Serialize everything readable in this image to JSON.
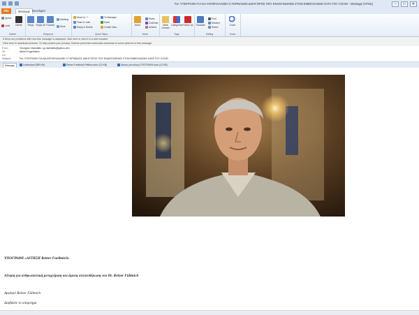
{
  "window": {
    "title": "Fw: ΥΠΟΓΡΑΦΗ ΓΙΑ ΝΑ ΑΠΟΦΥΛΑΧΘΕΙ Ο ΓΕΡΜΑΝΟΣ ΔΙΚΗΓΟΡΟΣ ΠΟΥ ΕΝΑΝΤΙΩΘΗΚΕ ΣΤΟΝ ΕΜΒΟΛΙΑΣΜΟ ΚΑΤΑ ΤΟΥ COVID - Message (HTML)",
    "controls": [
      "–",
      "□",
      "✕"
    ]
  },
  "tabs": {
    "file": "File",
    "message": "Message",
    "developer": "Developer"
  },
  "ribbon": {
    "delete_group": {
      "label": "Delete",
      "ignore": "Ignore",
      "junk": "Junk",
      "delete": "Delete"
    },
    "respond_group": {
      "label": "Respond",
      "reply": "Reply",
      "reply_all": "Reply All",
      "forward": "Forward",
      "meeting": "Meeting",
      "more": "More"
    },
    "quicksteps_group": {
      "label": "Quick Steps",
      "move_to": "Move to: ?",
      "team_email": "Team E-mail",
      "reply_delete": "Reply & Delete",
      "to_manager": "To Manager",
      "done": "Done",
      "create_new": "Create New"
    },
    "move_group": {
      "label": "Move",
      "move": "Move",
      "rules": "Rules",
      "onenote": "OneNote",
      "actions": "Actions"
    },
    "tags_group": {
      "label": "Tags",
      "mark_unread": "Mark Unread",
      "categorize": "Categorize",
      "follow_up": "Follow Up"
    },
    "editing_group": {
      "label": "Editing",
      "translate": "Translate",
      "find": "Find",
      "related": "Related",
      "select": "Select"
    },
    "zoom_group": {
      "label": "Zoom",
      "zoom": "Zoom"
    }
  },
  "infobar": {
    "line1": "If there are problems with how this message is displayed, click here to view it in a web browser.",
    "line2": "Click here to download pictures. To help protect your privacy, Outlook prevented automatic download of some pictures in this message."
  },
  "header": {
    "from_label": "From:",
    "from_value": "Georgios Vlachakis <g.vlachakis@yahoo.de>",
    "to_label": "To:",
    "to_value": "Albert Engelmann",
    "cc_label": "Cc:",
    "cc_value": "",
    "subject_label": "Subject:",
    "subject_value": "Fw: ΥΠΟΓΡΑΦΗ ΓΙΑ ΝΑ ΑΠΟΦΥΛΑΧΘΕΙ Ο ΓΕΡΜΑΝΟΣ ΔΙΚΗΓΟΡΟΣ ΠΟΥ ΕΝΑΝΤΙΩΘΗΚΕ ΣΤΟΝ ΕΜΒΟΛΙΑΣΜΟ ΚΑΤΑ ΤΟΥ COVID"
  },
  "attachments": {
    "message_tab": "Message",
    "items": [
      "Lebenslauf (559 KB)",
      "Reiner Fuellmich Petition.docx (13 KB)",
      "Αίτηση για εκλογή ΥΠΟΓΡΑΦΗ.docx (12 KB)"
    ]
  },
  "body": {
    "line1": "ΥΠΟΓΡΑΦΗ «ΑΙΤΗΣΗ Reiner Fuellmich»",
    "line2": "Αίτηση για ανθρωπιστική μεταχείριση και άμεση απελευθέρωση του Dr. Reiner Füllmich",
    "line3": "Αγαπητέ Reiner Füllmich",
    "line4": "Διαβάστε το υπόμνημα"
  },
  "colors": {
    "file_tab": "#e07a1f",
    "ribbon_bg": "#e6edf7",
    "attachment_icon": "#2f6fbd"
  }
}
